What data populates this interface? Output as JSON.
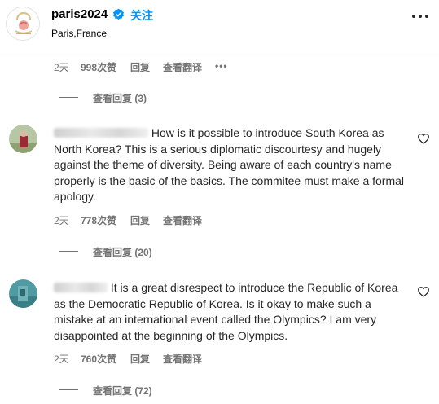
{
  "header": {
    "username": "paris2024",
    "follow_label": "关注",
    "location": "Paris,France"
  },
  "top_comment_meta": {
    "age": "2天",
    "likes": "998次赞",
    "reply_label": "回复",
    "translate_label": "查看翻译",
    "more": "•••"
  },
  "comments": [
    {
      "view_replies_top": "查看回复 (3)"
    },
    {
      "text": "How is it possible to introduce South Korea as North Korea? This is a serious diplomatic discourtesy and hugely against the theme of diversity. Being aware of each country's name properly is the basic of the basics. The commitee must make a formal apology.",
      "age": "2天",
      "likes": "778次赞",
      "reply_label": "回复",
      "translate_label": "查看翻译",
      "view_replies": "查看回复 (20)"
    },
    {
      "text": "It is a great disrespect to introduce the Republic of Korea as the Democratic Republic of Korea. Is it okay to make such a mistake at an international event called the Olympics? I am very disappointed at the beginning of the Olympics.",
      "age": "2天",
      "likes": "760次赞",
      "reply_label": "回复",
      "translate_label": "查看翻译",
      "view_replies": "查看回复 (72)"
    }
  ],
  "colors": {
    "follow_blue": "#0095f6",
    "verified_blue": "#0095f6",
    "meta_gray": "#737373"
  },
  "icons": [
    "verified-badge-icon",
    "more-icon",
    "heart-icon"
  ]
}
